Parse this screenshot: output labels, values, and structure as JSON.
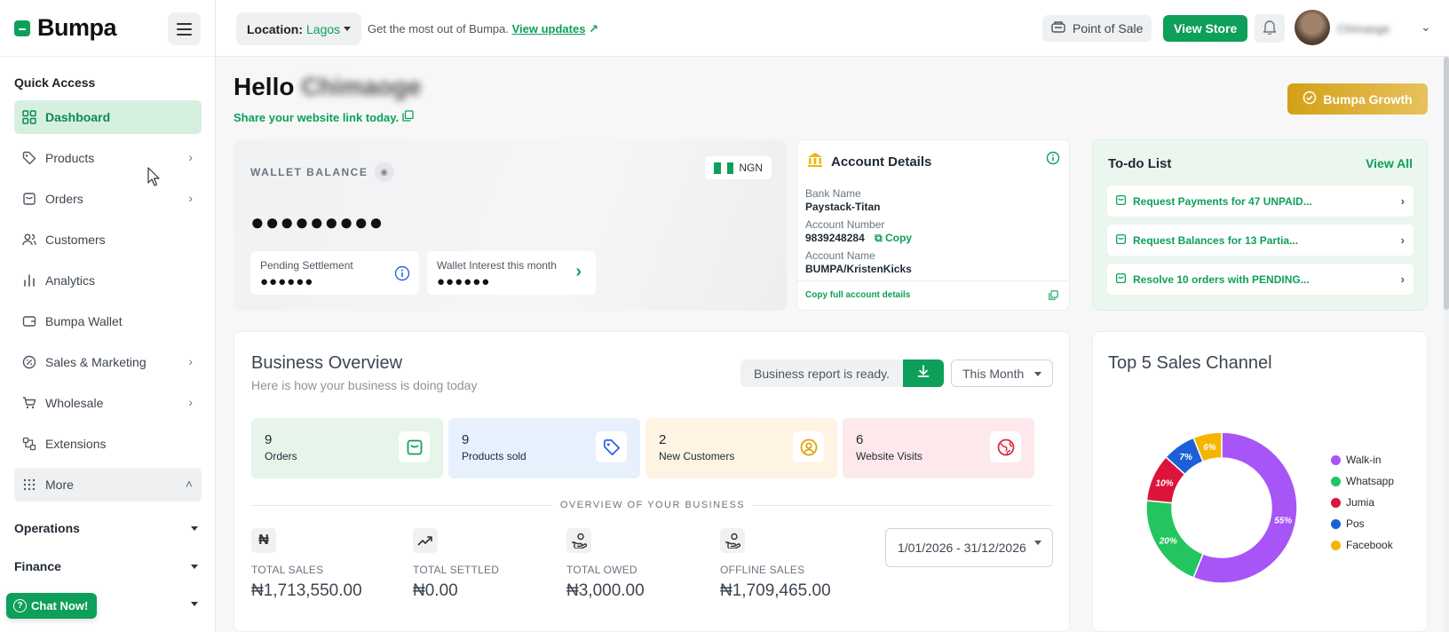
{
  "brand": {
    "name": "Bumpa"
  },
  "sidebar": {
    "quick_access_title": "Quick Access",
    "items": [
      {
        "label": "Dashboard",
        "icon": "grid-icon",
        "active": true
      },
      {
        "label": "Products",
        "icon": "tag-icon",
        "has_chevron": true
      },
      {
        "label": "Orders",
        "icon": "bag-icon",
        "has_chevron": true
      },
      {
        "label": "Customers",
        "icon": "users-icon"
      },
      {
        "label": "Analytics",
        "icon": "bar-chart-icon"
      },
      {
        "label": "Bumpa Wallet",
        "icon": "wallet-icon"
      },
      {
        "label": "Sales & Marketing",
        "icon": "percent-icon",
        "has_chevron": true
      },
      {
        "label": "Wholesale",
        "icon": "cart-icon",
        "has_chevron": true
      },
      {
        "label": "Extensions",
        "icon": "puzzle-icon"
      },
      {
        "label": "More",
        "icon": "dots-grid-icon",
        "expanded": true
      }
    ],
    "sections": [
      "Operations",
      "Finance"
    ],
    "chat_label": "Chat Now!"
  },
  "topbar": {
    "location_label": "Location:",
    "location_value": "Lagos",
    "tagline": "Get the most out of Bumpa.",
    "updates_link": "View updates",
    "pos_label": "Point of Sale",
    "store_label": "View Store",
    "user_name": "Chimaoge"
  },
  "main": {
    "greeting": "Hello",
    "greeting_name": "Chimaoge",
    "share_link": "Share your website link today.",
    "growth_button": "Bumpa Growth"
  },
  "wallet": {
    "title": "WALLET BALANCE",
    "currency": "NGN",
    "balance_masked": "●●●●●●●●●",
    "pending_label": "Pending Settlement",
    "pending_masked": "●●●●●●",
    "interest_label": "Wallet Interest this month",
    "interest_masked": "●●●●●●"
  },
  "account": {
    "title": "Account Details",
    "bank_label": "Bank Name",
    "bank_value": "Paystack-Titan",
    "number_label": "Account Number",
    "number_value": "9839248284",
    "copy_label": "Copy",
    "name_label": "Account Name",
    "name_value": "BUMPA/KristenKicks",
    "copy_full": "Copy full account details"
  },
  "todo": {
    "title": "To-do List",
    "view_all": "View All",
    "items": [
      "Request Payments for 47 UNPAID...",
      "Request Balances for 13 Partia...",
      "Resolve 10 orders with PENDING..."
    ]
  },
  "overview": {
    "title": "Business Overview",
    "subtitle": "Here is how your business is doing today",
    "report_label": "Business report is ready.",
    "period": "This Month",
    "stats": [
      {
        "value": "9",
        "label": "Orders",
        "bg": "#e6f4ea",
        "icon": "bag-icon",
        "color": "#0e9f5a"
      },
      {
        "value": "9",
        "label": "Products sold",
        "bg": "#e7f0fd",
        "icon": "tag-icon",
        "color": "#2563eb"
      },
      {
        "value": "2",
        "label": "New Customers",
        "bg": "#fff3e3",
        "icon": "user-circle-icon",
        "color": "#e3a008"
      },
      {
        "value": "6",
        "label": "Website Visits",
        "bg": "#fde8ec",
        "icon": "globe-icon",
        "color": "#dc2640"
      }
    ],
    "divider_label": "OVERVIEW OF YOUR BUSINESS",
    "metrics": [
      {
        "label": "TOTAL SALES",
        "value": "₦1,713,550.00",
        "icon": "naira-icon"
      },
      {
        "label": "TOTAL SETTLED",
        "value": "₦0.00",
        "icon": "trend-up-icon"
      },
      {
        "label": "TOTAL OWED",
        "value": "₦3,000.00",
        "icon": "hand-coins-icon"
      },
      {
        "label": "OFFLINE SALES",
        "value": "₦1,709,465.00",
        "icon": "hand-coins-icon"
      }
    ],
    "date_range": "1/01/2026 - 31/12/2026"
  },
  "chart_data": {
    "type": "pie",
    "title": "Top 5 Sales Channel",
    "donut": true,
    "legend_position": "right",
    "categories": [
      "Walk-in",
      "Whatsapp",
      "Jumia",
      "Pos",
      "Facebook"
    ],
    "values": [
      55,
      20,
      10,
      7,
      6
    ],
    "value_labels": [
      "55%",
      "20%",
      "10%",
      "7%",
      "6%"
    ],
    "colors": [
      "#a855f7",
      "#22c55e",
      "#dc143c",
      "#1d5fd6",
      "#f5b400"
    ]
  },
  "colors": {
    "accent": "#0e9f5a",
    "gold": "#d4a017"
  }
}
